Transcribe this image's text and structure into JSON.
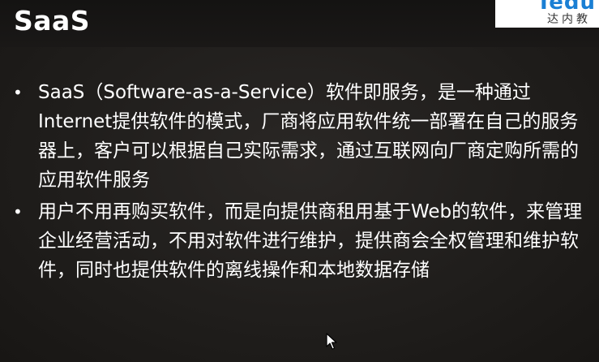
{
  "slide": {
    "title": "SaaS",
    "logo": {
      "mark": "Tedu",
      "text": "达内教"
    },
    "bullets": [
      {
        "marker": "•",
        "text": "SaaS（Software-as-a-Service）软件即服务，是一种通过Internet提供软件的模式，厂商将应用软件统一部署在自己的服务器上，客户可以根据自己实际需求，通过互联网向厂商定购所需的应用软件服务"
      },
      {
        "marker": "•",
        "text": "用户不用再购买软件，而是向提供商租用基于Web的软件，来管理企业经营活动，不用对软件进行维护，提供商会全权管理和维护软件，同时也提供软件的离线操作和本地数据存储"
      }
    ]
  },
  "cursor": {
    "icon": "mouse-pointer-icon"
  }
}
